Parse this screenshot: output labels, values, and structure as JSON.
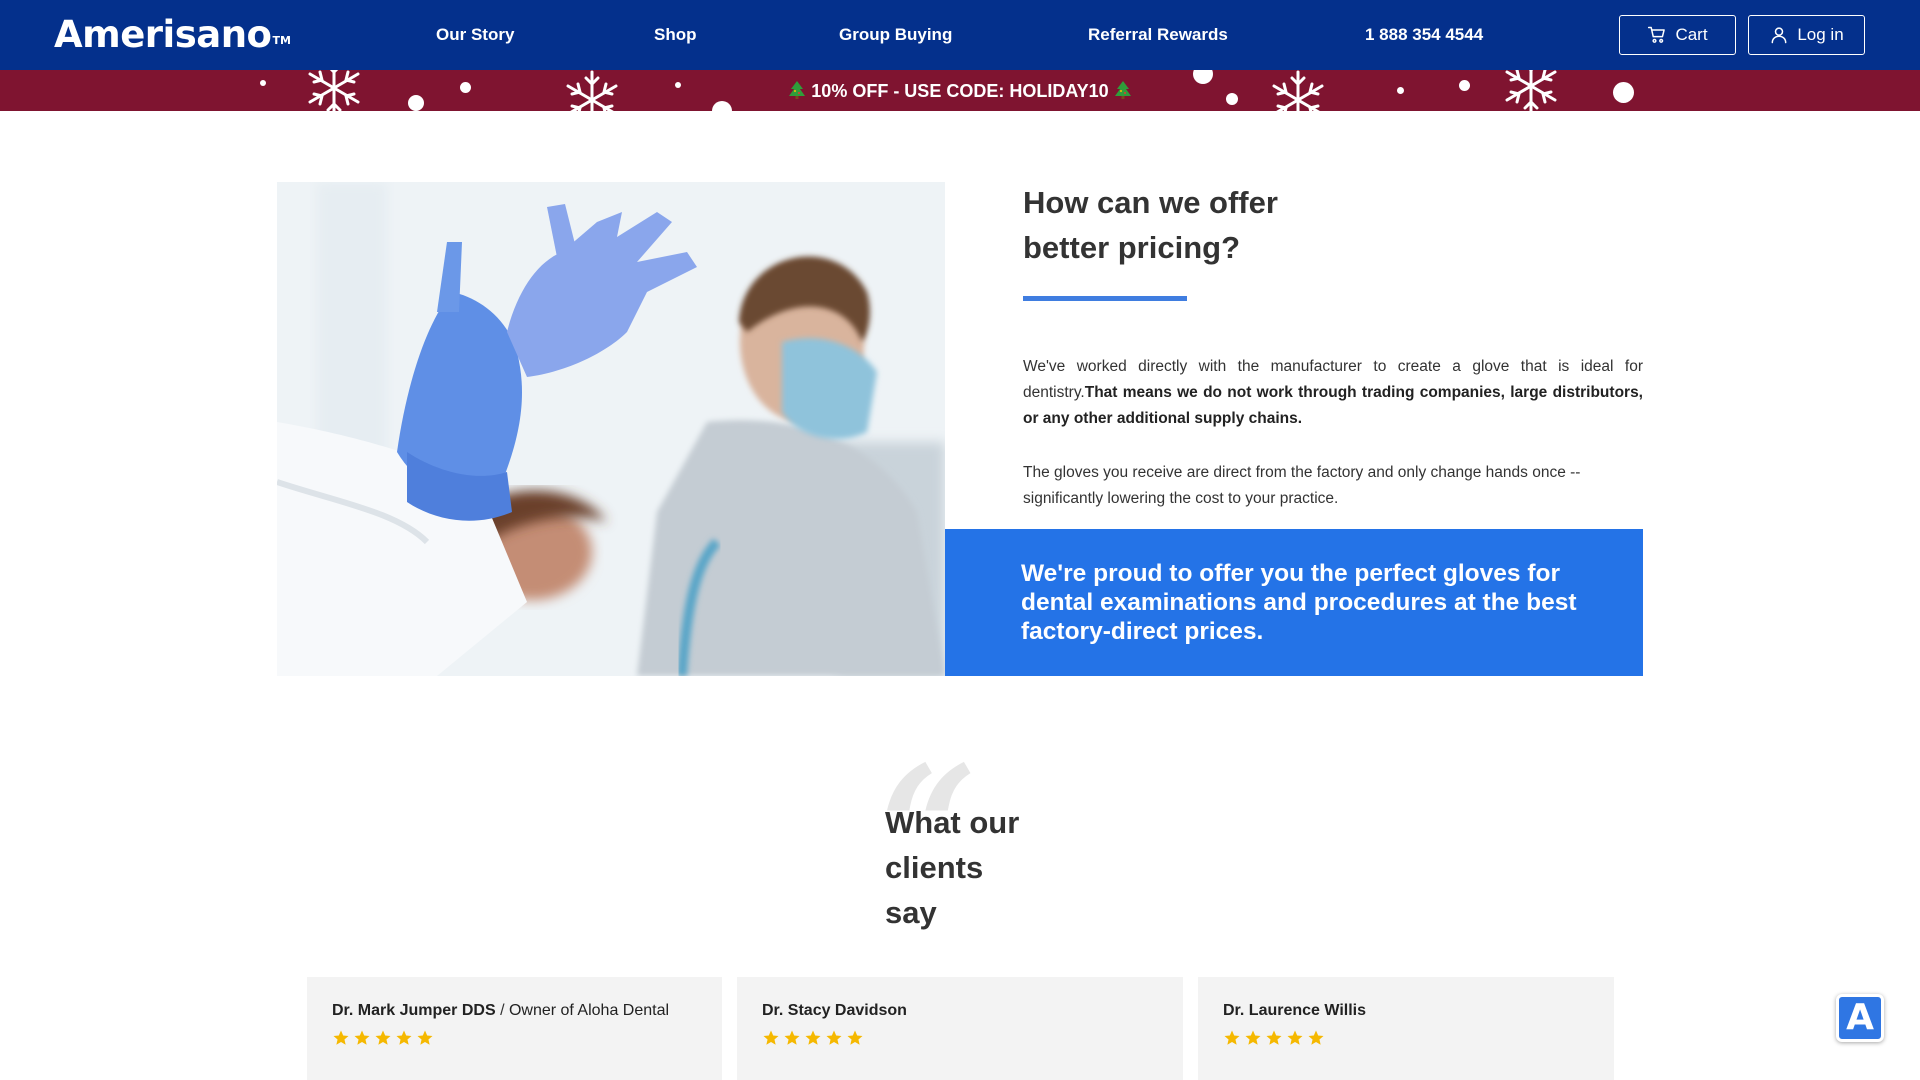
{
  "header": {
    "logo": "Amerisano",
    "logo_tm": "TM",
    "nav": [
      "Our Story",
      "Shop",
      "Group Buying",
      "Referral Rewards",
      "1 888 354 4544"
    ],
    "cart_label": "Cart",
    "login_label": "Log in"
  },
  "promo": {
    "text": "10% OFF - USE CODE: HOLIDAY10"
  },
  "pricing": {
    "title_line1": "How can we offer",
    "title_line2": "better pricing?",
    "p1_normal": "We've worked directly with the manufacturer to create a glove that is ideal for dentistry.",
    "p1_bold": "That means we do not work through trading companies, large distributors, or any other additional supply chains.",
    "p2": "The gloves you receive are direct from the factory and only change hands once -- significantly lowering the cost to your practice.",
    "banner": "We're proud to offer you the perfect gloves for dental examinations and procedures at the best factory-direct prices."
  },
  "testimonials": {
    "title_line1": "What our",
    "title_line2": "clients",
    "title_line3": "say",
    "items": [
      {
        "name": "Dr. Mark Jumper DDS",
        "role": "Owner of Aloha Dental",
        "stars": 5
      },
      {
        "name": "Dr. Stacy Davidson",
        "role": "",
        "stars": 5
      },
      {
        "name": "Dr. Laurence Willis",
        "role": "",
        "stars": 5
      }
    ]
  },
  "colors": {
    "header_bg": "#04308c",
    "promo_bg": "#7f1430",
    "accent_blue": "#2473e7",
    "star": "#f5b800"
  },
  "icons": {
    "cart": "cart-icon",
    "login": "user-icon",
    "accessibility": "accessibility-icon"
  },
  "accessibility_label": "A"
}
